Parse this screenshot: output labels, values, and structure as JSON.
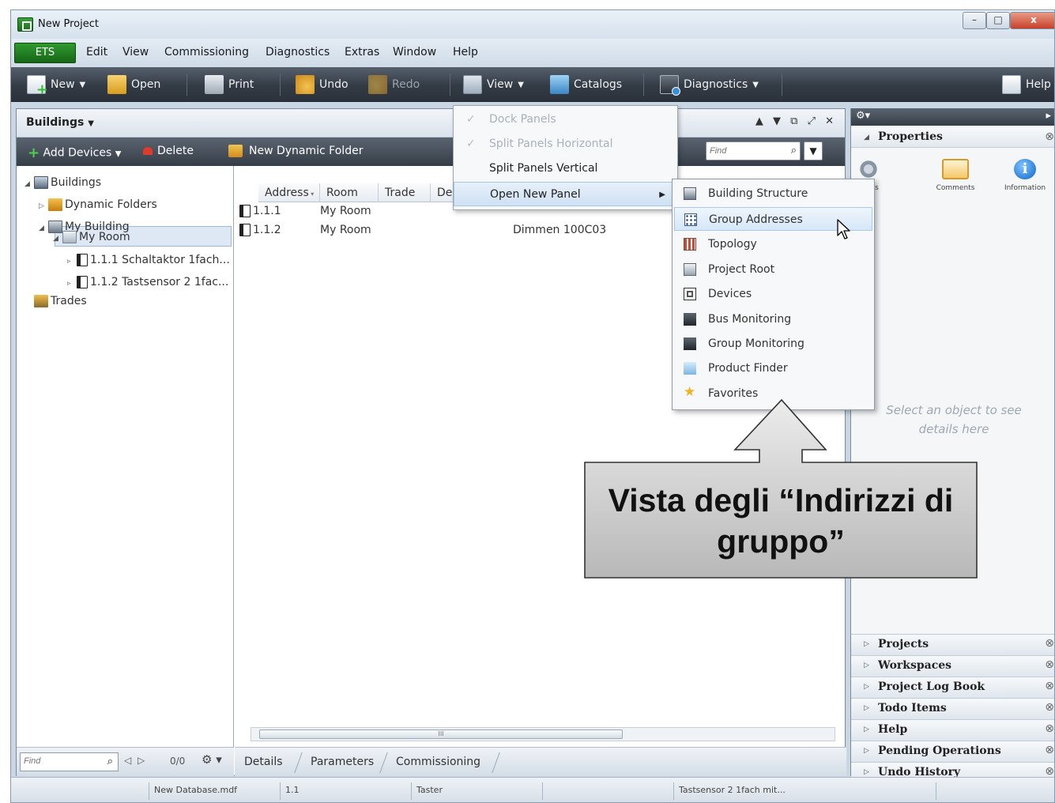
{
  "window": {
    "title": "New Project",
    "controls": {
      "minimize": "–",
      "maximize": "□",
      "close": "x"
    }
  },
  "menubar": {
    "items": [
      "ETS",
      "Edit",
      "View",
      "Commissioning",
      "Diagnostics",
      "Extras",
      "Window",
      "Help"
    ]
  },
  "toolbar": {
    "new": "New",
    "open": "Open",
    "print": "Print",
    "undo": "Undo",
    "redo": "Redo",
    "view": "View",
    "catalogs": "Catalogs",
    "diagnostics": "Diagnostics",
    "help": "Help"
  },
  "panel": {
    "title": "Buildings",
    "controls": "▲ ▼  ⧉ ⤢ ✕",
    "toolbar": {
      "add_devices": "Add Devices",
      "delete": "Delete",
      "new_dynamic_folder": "New Dynamic Folder",
      "find_placeholder": "Find"
    }
  },
  "tree": {
    "nodes": [
      {
        "label": "Buildings",
        "icon": "buildings-icon"
      },
      {
        "label": "Dynamic Folders",
        "icon": "dynamic-folder-icon"
      },
      {
        "label": "My Building",
        "icon": "building-icon"
      },
      {
        "label": "My Room",
        "icon": "room-icon"
      },
      {
        "label": "1.1.1  Schaltaktor 1fach...",
        "icon": "device-icon"
      },
      {
        "label": "1.1.2  Tastsensor 2 1fac...",
        "icon": "device-icon"
      },
      {
        "label": "Trades",
        "icon": "trades-icon"
      }
    ],
    "bottom": {
      "find_placeholder": "Find",
      "nav": "◁ ▷",
      "count": "0/0",
      "gear": "⚙ ▾"
    }
  },
  "grid": {
    "columns": [
      "Address",
      "Room",
      "Trade",
      "De"
    ],
    "rows": [
      {
        "address": "1.1.1",
        "room": "My Room",
        "desc": ""
      },
      {
        "address": "1.1.2",
        "room": "My Room",
        "desc": "Dimmen 100C03"
      }
    ],
    "scroll_grip": "III",
    "tabs": [
      "Details",
      "Parameters",
      "Commissioning"
    ]
  },
  "view_menu": {
    "items": [
      {
        "label": "Dock Panels",
        "checked": true,
        "disabled": true
      },
      {
        "label": "Split Panels Horizontal",
        "checked": true,
        "disabled": true
      },
      {
        "label": "Split Panels Vertical",
        "checked": false,
        "disabled": false
      },
      {
        "label": "Open New Panel",
        "checked": false,
        "disabled": false
      }
    ]
  },
  "submenu": {
    "items": [
      {
        "label": "Building Structure",
        "icon": "building-structure-icon"
      },
      {
        "label": "Group Addresses",
        "icon": "group-addresses-icon"
      },
      {
        "label": "Topology",
        "icon": "topology-icon"
      },
      {
        "label": "Project Root",
        "icon": "project-root-icon"
      },
      {
        "label": "Devices",
        "icon": "devices-icon"
      },
      {
        "label": "Bus Monitoring",
        "icon": "bus-monitoring-icon"
      },
      {
        "label": "Group Monitoring",
        "icon": "group-monitoring-icon"
      },
      {
        "label": "Product Finder",
        "icon": "product-finder-icon"
      },
      {
        "label": "Favorites",
        "icon": "favorites-icon"
      }
    ]
  },
  "right_panel": {
    "properties_title": "Properties",
    "tabs": [
      "ttings",
      "Comments",
      "Information"
    ],
    "empty_message": "Select an object to see details here",
    "sections": [
      "Projects",
      "Workspaces",
      "Project Log Book",
      "Todo Items",
      "Help",
      "Pending Operations",
      "Undo History"
    ]
  },
  "statusbar": {
    "fields": [
      "",
      "New Database.mdf",
      "1.1",
      "Taster",
      "",
      "Tastsensor 2 1fach mit..."
    ]
  },
  "callout": {
    "text": "Vista degli “Indirizzi di gruppo”"
  }
}
